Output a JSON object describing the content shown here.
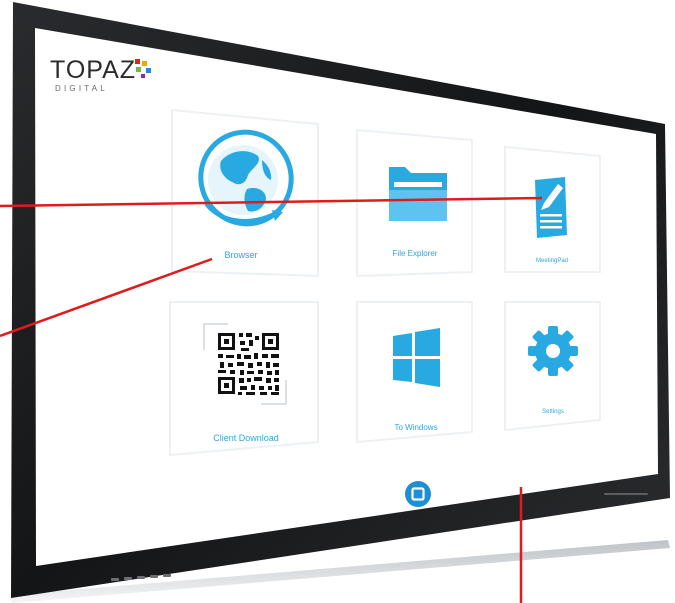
{
  "brand": {
    "name": "TOPAZ",
    "sub": "DIGITAL",
    "dot_colors": [
      "#e2231a",
      "#f7a600",
      "#1e88e5",
      "#7cb342",
      "#8e24aa"
    ]
  },
  "tiles": [
    {
      "label": "Browser",
      "icon": "globe-icon"
    },
    {
      "label": "File Explorer",
      "icon": "folder-icon"
    },
    {
      "label": "MeetingPad",
      "icon": "notepad-pen-icon"
    },
    {
      "label": "Client Download",
      "icon": "qr-code-icon"
    },
    {
      "label": "To Windows",
      "icon": "windows-logo-icon"
    },
    {
      "label": "Settings",
      "icon": "gear-icon"
    }
  ],
  "home_button": {
    "icon": "home-square-icon"
  },
  "colors": {
    "accent": "#29a9e1",
    "bezel": "#1b1c1e",
    "screen": "#ffffff",
    "callout_line": "#e01b1b"
  }
}
